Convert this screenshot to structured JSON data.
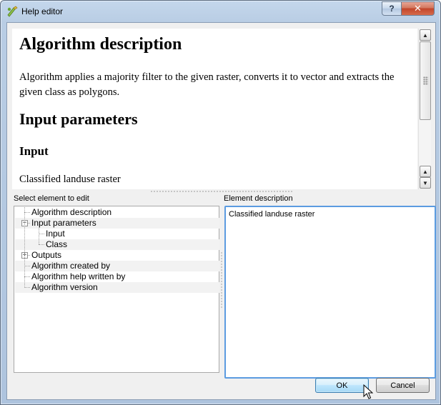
{
  "window": {
    "title": "Help editor"
  },
  "titlebar": {
    "help_label": "?",
    "close_label": "✕"
  },
  "preview": {
    "heading_description": "Algorithm description",
    "description_text": "Algorithm applies a majority filter to the given raster, converts it to vector and extracts the given class as polygons.",
    "heading_input_parameters": "Input parameters",
    "heading_input": "Input",
    "input_text": "Classified landuse raster"
  },
  "tree": {
    "label": "Select element to edit",
    "items": [
      {
        "label": "Algorithm description",
        "level": 0,
        "expander": ""
      },
      {
        "label": "Input parameters",
        "level": 0,
        "expander": "−"
      },
      {
        "label": "Input",
        "level": 1,
        "expander": ""
      },
      {
        "label": "Class",
        "level": 1,
        "expander": ""
      },
      {
        "label": "Outputs",
        "level": 0,
        "expander": "+"
      },
      {
        "label": "Algorithm created by",
        "level": 0,
        "expander": ""
      },
      {
        "label": "Algorithm help written by",
        "level": 0,
        "expander": ""
      },
      {
        "label": "Algorithm version",
        "level": 0,
        "expander": ""
      }
    ]
  },
  "element_description": {
    "label": "Element description",
    "value": "Classified landuse raster"
  },
  "buttons": {
    "ok": "OK",
    "cancel": "Cancel"
  },
  "colors": {
    "focus_border": "#5b9be0",
    "close_button": "#c2452a"
  }
}
